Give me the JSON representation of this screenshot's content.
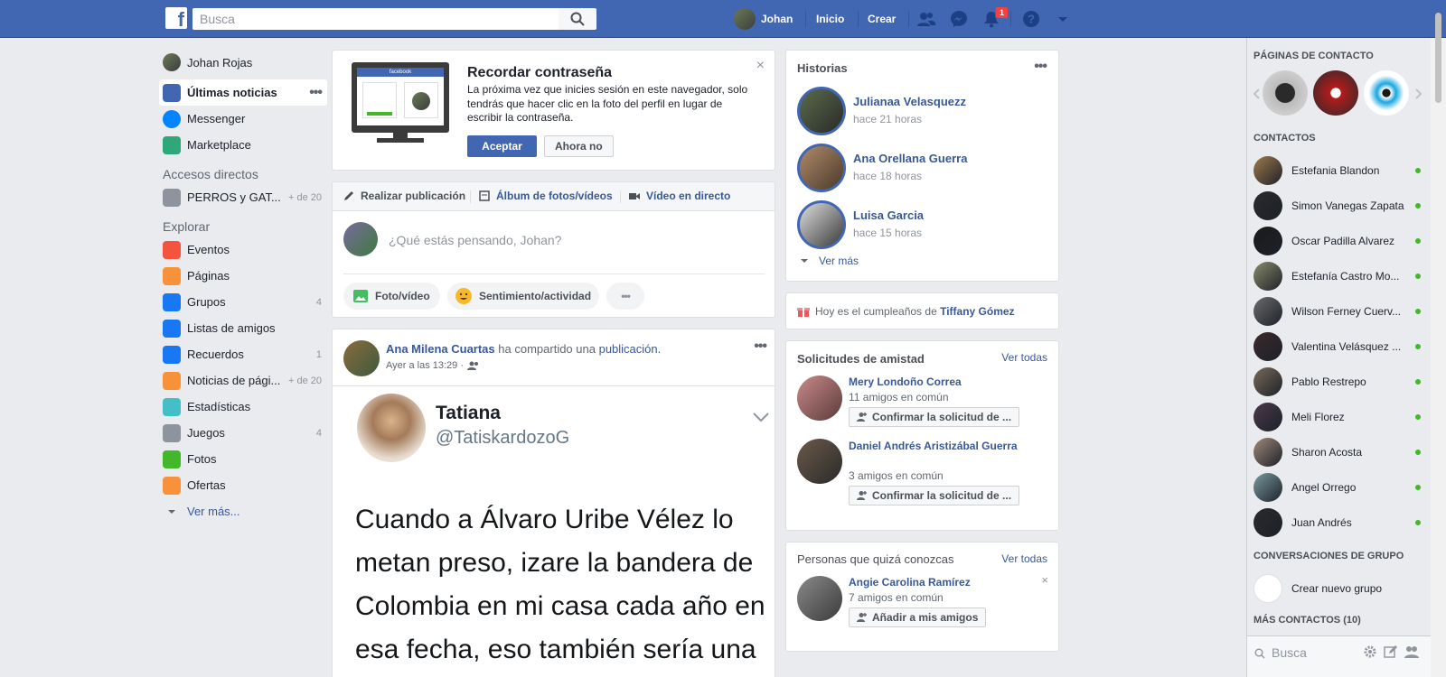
{
  "topbar": {
    "logo": "f",
    "search_placeholder": "Busca",
    "profile_name": "Johan",
    "home": "Inicio",
    "create": "Crear",
    "notifications_count": "1"
  },
  "left_nav": {
    "profile_name": "Johan Rojas",
    "main": [
      {
        "label": "Últimas noticias",
        "icon": "news-feed-icon"
      },
      {
        "label": "Messenger",
        "icon": "messenger-icon"
      },
      {
        "label": "Marketplace",
        "icon": "marketplace-icon"
      }
    ],
    "shortcuts_title": "Accesos directos",
    "shortcuts": [
      {
        "label": "PERROS y GAT...",
        "count": "+ de 20"
      }
    ],
    "explore_title": "Explorar",
    "explore": [
      {
        "label": "Eventos",
        "count": "",
        "color": "#f5533d"
      },
      {
        "label": "Páginas",
        "count": "",
        "color": "#f7923b"
      },
      {
        "label": "Grupos",
        "count": "4",
        "color": "#1877f2"
      },
      {
        "label": "Listas de amigos",
        "count": "",
        "color": "#1877f2"
      },
      {
        "label": "Recuerdos",
        "count": "1",
        "color": "#1877f2"
      },
      {
        "label": "Noticias de pági...",
        "count": "+ de 20",
        "color": "#f7923b"
      },
      {
        "label": "Estadísticas",
        "count": "",
        "color": "#44bec7"
      },
      {
        "label": "Juegos",
        "count": "4",
        "color": "#8d949e"
      },
      {
        "label": "Fotos",
        "count": "",
        "color": "#42b72a"
      },
      {
        "label": "Ofertas",
        "count": "",
        "color": "#f7923b"
      }
    ],
    "see_more": "Ver más..."
  },
  "password_card": {
    "title": "Recordar contraseña",
    "body": "La próxima vez que inicies sesión en este navegador, solo tendrás que hacer clic en la foto del perfil en lugar de escribir la contraseña.",
    "accept": "Aceptar",
    "decline": "Ahora no",
    "mock_label": "facebook"
  },
  "composer": {
    "tab_post": "Realizar publicación",
    "tab_album": "Álbum de fotos/vídeos",
    "tab_live": "Vídeo en directo",
    "placeholder": "¿Qué estás pensando, Johan?",
    "photo": "Foto/vídeo",
    "feeling": "Sentimiento/actividad"
  },
  "post": {
    "author": "Ana Milena Cuartas",
    "action": "ha compartido una",
    "object": "publicación.",
    "time": "Ayer a las 13:29 ·",
    "tweet_name": "Tatiana",
    "tweet_handle": "@TatiskardozoG",
    "tweet_text": "Cuando a Álvaro Uribe Vélez lo metan preso, izare la bandera de Colombia en mi casa cada año en esa fecha, eso también sería una"
  },
  "stories": {
    "title": "Historias",
    "items": [
      {
        "name": "Julianaa Velasquezz",
        "time": "hace 21 horas"
      },
      {
        "name": "Ana Orellana Guerra",
        "time": "hace 18 horas"
      },
      {
        "name": "Luisa Garcia",
        "time": "hace 15 horas"
      }
    ],
    "see_more": "Ver más"
  },
  "birthday": {
    "prefix": "Hoy es el cumpleaños de",
    "name": "Tiffany Gómez"
  },
  "friend_requests": {
    "title": "Solicitudes de amistad",
    "see_all": "Ver todas",
    "items": [
      {
        "name": "Mery Londoño Correa",
        "mutual": "11 amigos en común",
        "button": "Confirmar la solicitud de ..."
      },
      {
        "name": "Daniel Andrés Aristizábal Guerra",
        "mutual": "3 amigos en común",
        "button": "Confirmar la solicitud de ..."
      }
    ]
  },
  "pymk": {
    "title": "Personas que quizá conozcas",
    "see_all": "Ver todas",
    "name": "Angie Carolina Ramírez",
    "mutual": "7 amigos en común",
    "button": "Añadir a mis amigos"
  },
  "right": {
    "pages_title": "PÁGINAS DE CONTACTO",
    "contacts_title": "CONTACTOS",
    "contacts": [
      "Estefania Blandon",
      "Simon Vanegas Zapata",
      "Oscar Padilla Alvarez",
      "Estefanía Castro Mo...",
      "Wilson Ferney Cuerv...",
      "Valentina Velásquez ...",
      "Pablo Restrepo",
      "Meli Florez",
      "Sharon Acosta",
      "Angel Orrego",
      "Juan Andrés"
    ],
    "group_title": "CONVERSACIONES DE GRUPO",
    "new_group": "Crear nuevo grupo",
    "more_contacts": "MÁS CONTACTOS (10)",
    "search_placeholder": "Busca"
  }
}
